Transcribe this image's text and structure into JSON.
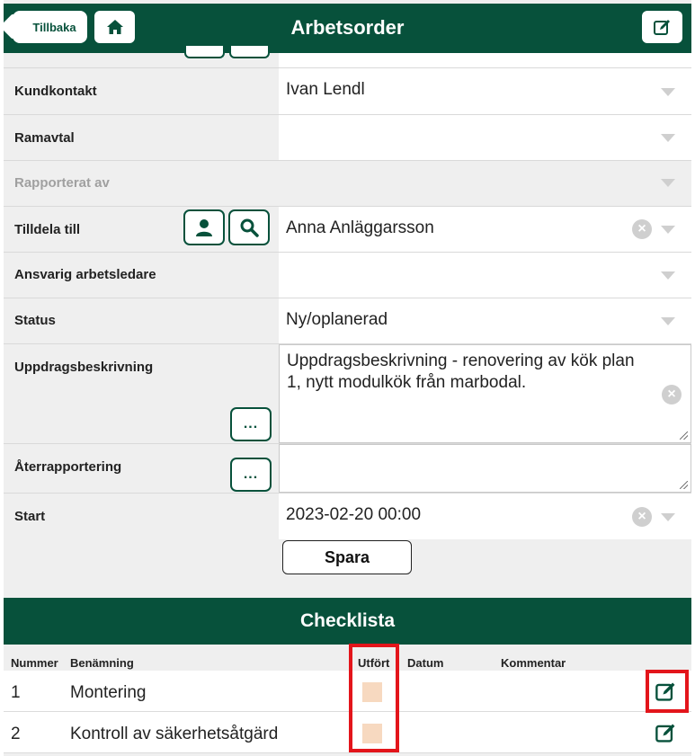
{
  "header": {
    "back_label": "Tillbaka",
    "title": "Arbetsorder",
    "home_icon": "home-icon",
    "edit_icon": "edit-icon"
  },
  "form": {
    "kundkontakt": {
      "label": "Kundkontakt",
      "value": "Ivan Lendl"
    },
    "ramavtal": {
      "label": "Ramavtal",
      "value": ""
    },
    "rapporterat_av": {
      "label": "Rapporterat av",
      "value": ""
    },
    "tilldela_till": {
      "label": "Tilldela till",
      "value": "Anna Anläggarsson"
    },
    "ansvarig": {
      "label": "Ansvarig arbetsledare",
      "value": ""
    },
    "status": {
      "label": "Status",
      "value": "Ny/oplanerad"
    },
    "uppdragsbeskrivning": {
      "label": "Uppdragsbeskrivning",
      "value": "Uppdragsbeskrivning - renovering av kök plan 1, nytt modulkök från marbodal.",
      "more_label": "..."
    },
    "aterrapportering": {
      "label": "Återrapportering",
      "value": "",
      "more_label": "..."
    },
    "start": {
      "label": "Start",
      "value": "2023-02-20 00:00"
    },
    "clear_symbol": "×",
    "save_label": "Spara"
  },
  "checklist": {
    "title": "Checklista",
    "columns": [
      "Nummer",
      "Benämning",
      "Utfört",
      "Datum",
      "Kommentar"
    ],
    "rows": [
      {
        "number": "1",
        "name": "Montering",
        "done": false
      },
      {
        "number": "2",
        "name": "Kontroll av säkerhetsåtgärd",
        "done": false
      }
    ]
  },
  "colors": {
    "brand": "#07513b",
    "highlight": "#e3151b",
    "checkbox": "#f7d9c0"
  }
}
